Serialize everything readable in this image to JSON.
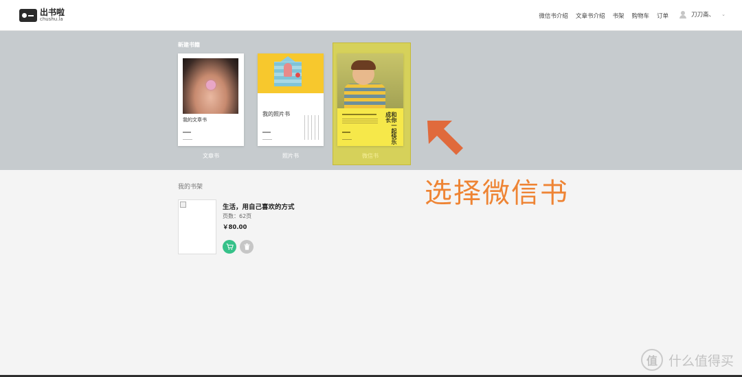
{
  "brand": {
    "name_cn": "出书啦",
    "name_en": "chushu.la"
  },
  "nav": {
    "items": [
      "微信书介绍",
      "文章书介绍",
      "书架",
      "购物车",
      "订单"
    ]
  },
  "user": {
    "name": "刀刀斋、"
  },
  "new_book": {
    "title": "新建书籍",
    "cards": [
      {
        "caption": "文章书",
        "cover_title": "我的文章书"
      },
      {
        "caption": "照片书",
        "cover_title": "我的照片书"
      },
      {
        "caption": "微信书",
        "cover_title": "和你一起快乐成长"
      }
    ]
  },
  "annotation": {
    "text": "选择微信书"
  },
  "shelf": {
    "title": "我的书架",
    "book": {
      "title": "生活，用自己喜欢的方式",
      "pages": "页数：62页",
      "price": "￥80.00"
    }
  },
  "watermark": {
    "text": "什么值得买",
    "glyph": "值"
  },
  "colors": {
    "accent_green": "#36c189",
    "selected_frame": "#d6d15a",
    "annotation": "#ee8434",
    "band": "#c6cbce"
  }
}
